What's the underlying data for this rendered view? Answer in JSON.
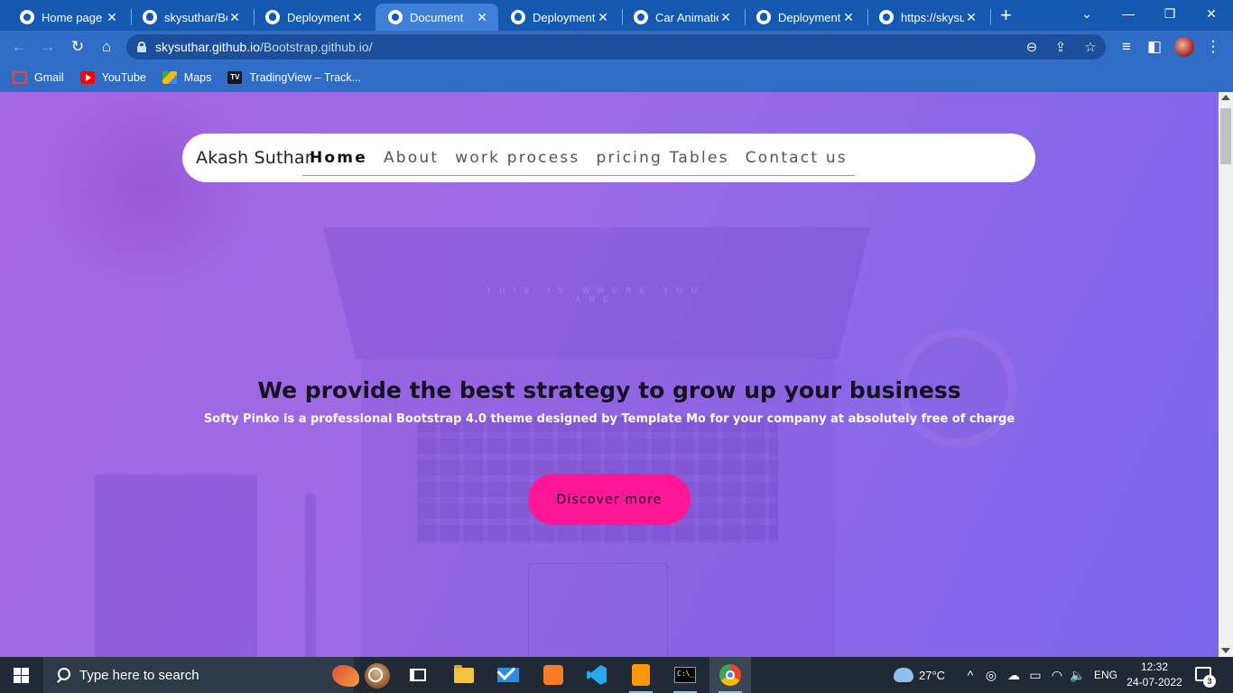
{
  "browser": {
    "tabs": [
      {
        "title": "Home page",
        "icon": "globe-icon"
      },
      {
        "title": "skysuthar/Bo",
        "icon": "github-icon"
      },
      {
        "title": "Deployments",
        "icon": "github-icon"
      },
      {
        "title": "Document",
        "icon": "globe-icon",
        "active": true
      },
      {
        "title": "Deployments",
        "icon": "github-icon"
      },
      {
        "title": "Car Animatio",
        "icon": "globe-icon"
      },
      {
        "title": "Deployments",
        "icon": "github-icon"
      },
      {
        "title": "https://skysut",
        "icon": "globe-icon"
      }
    ],
    "tab_close_glyph": "✕",
    "new_tab_glyph": "+",
    "window_controls": {
      "collapse": "⌄",
      "minimize": "—",
      "restore": "❐",
      "close": "✕"
    },
    "nav_icons": {
      "back": "←",
      "forward": "→",
      "reload": "↻",
      "home": "⌂"
    },
    "url": {
      "host": "skysuthar.github.io",
      "path": "/Bootstrap.github.io/"
    },
    "omnibox_icons": {
      "zoom": "⊖",
      "share": "⇪",
      "bookmark": "☆"
    },
    "toolbar_icons": {
      "media": "≡",
      "sidepanel": "◧",
      "menu": "⋮"
    },
    "bookmarks": [
      {
        "label": "Gmail",
        "icon": "gmail-icon"
      },
      {
        "label": "YouTube",
        "icon": "youtube-icon"
      },
      {
        "label": "Maps",
        "icon": "maps-icon"
      },
      {
        "label": "TradingView – Track...",
        "icon": "tradingview-icon",
        "icon_text": "TV"
      }
    ]
  },
  "page": {
    "background_gradient": [
      "#a567e3",
      "#7b66ec"
    ],
    "nav": {
      "brand": "Akash Suthar",
      "links": [
        "Home",
        "About",
        "work process",
        "pricing Tables",
        "Contact us"
      ],
      "active_index": 0
    },
    "screen_text": "THIS IS WHERE YOU ARE",
    "hero": {
      "title": "We provide the best strategy to grow up your business",
      "subtitle": "Softy Pinko is a professional Bootstrap 4.0 theme designed by Template Mo for your company at absolutely free of charge",
      "cta_label": "Discover more",
      "cta_color": "#fe1797"
    }
  },
  "taskbar": {
    "search_placeholder": "Type here to search",
    "apps": [
      "cortana-icon",
      "task-view-icon",
      "file-explorer-icon",
      "mail-icon",
      "xampp-icon",
      "vscode-icon",
      "sublime-icon",
      "cmd-icon",
      "chrome-icon"
    ],
    "cmd_text": "C:\\_",
    "weather": "27°C",
    "tray_icons": {
      "chevron": "^",
      "meet": "◎",
      "cloud": "☁",
      "battery": "▭",
      "wifi": "◠",
      "volume": "🔈"
    },
    "language": "ENG",
    "time": "12:32",
    "date": "24-07-2022",
    "notification_count": "3"
  }
}
